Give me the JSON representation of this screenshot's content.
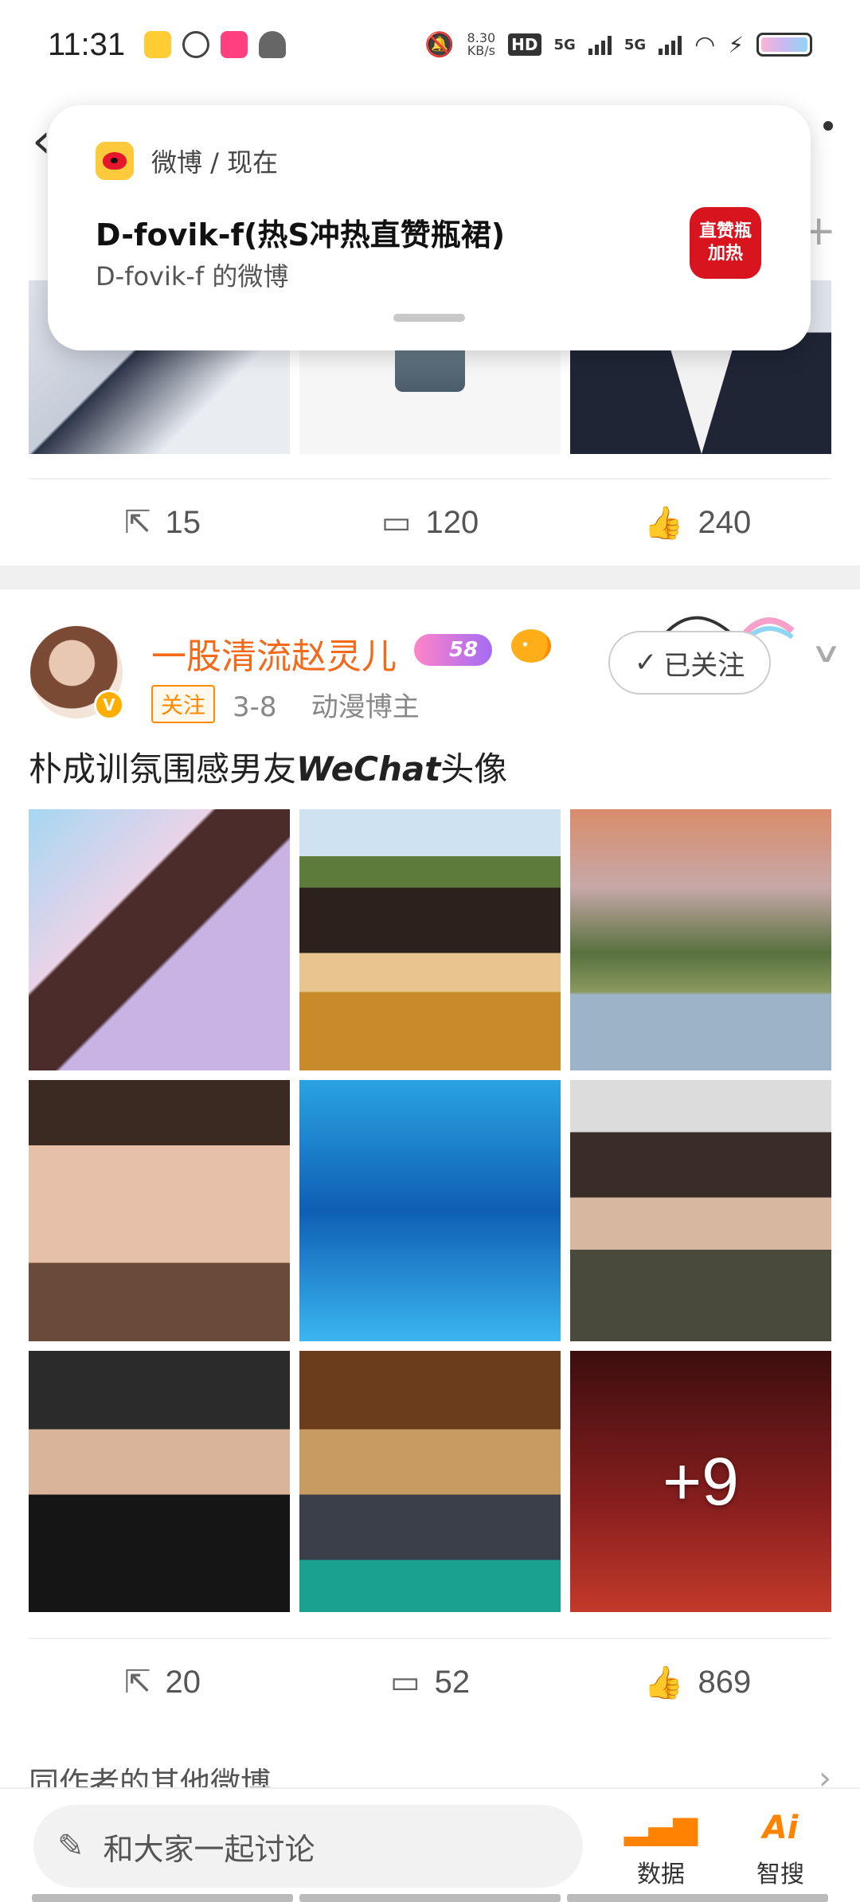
{
  "status_bar": {
    "time": "11:31",
    "net_speed_value": "8.30",
    "net_speed_unit": "KB/s",
    "hd_label": "HD",
    "signal_1": "5G",
    "signal_2": "5G"
  },
  "notification": {
    "source": "微博 / 现在",
    "title": "D-fovik-f(热S冲热直赞瓶裙)",
    "body": "D-fovik-f 的微博",
    "badge_line1": "直赞瓶",
    "badge_line2": "加热"
  },
  "prev_post": {
    "repost_count": "15",
    "comment_count": "120",
    "like_count": "240"
  },
  "post": {
    "username": "一股清流赵灵儿",
    "level": "58",
    "follow_tag": "关注",
    "date": "3-8",
    "category": "动漫博主",
    "followed_label": "已关注",
    "text_prefix": "朴成训氛围感男友",
    "text_bold": "WeChat",
    "text_suffix": "头像",
    "more_images": "+9",
    "repost_count": "20",
    "comment_count": "52",
    "like_count": "869"
  },
  "other_posts_label": "同作者的其他微博",
  "bottom_bar": {
    "comment_placeholder": "和大家一起讨论",
    "data_label": "数据",
    "search_label": "智搜",
    "search_icon_text": "Ai"
  }
}
